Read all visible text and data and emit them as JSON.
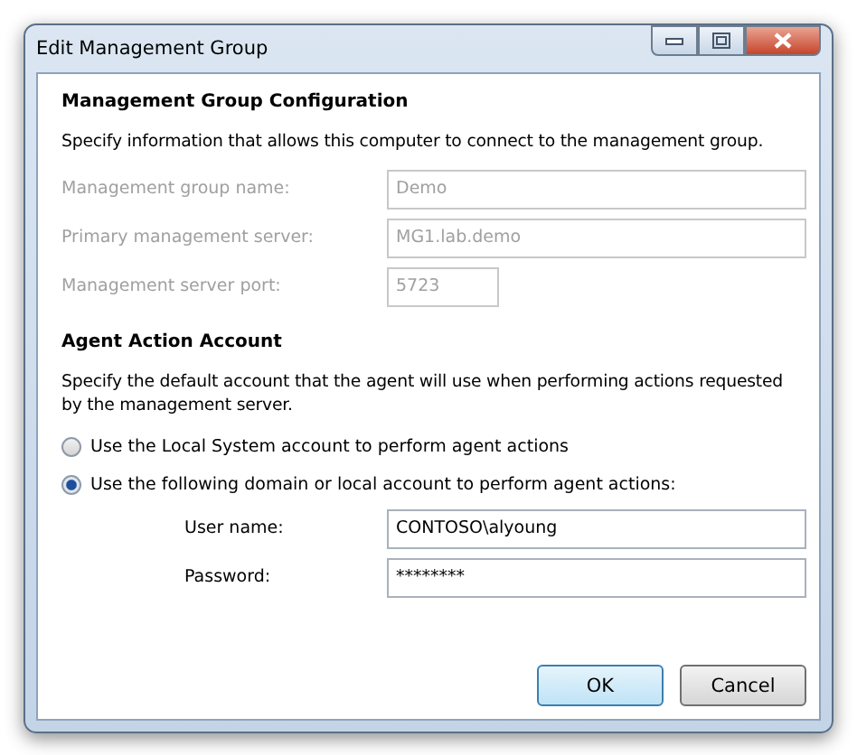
{
  "window": {
    "title": "Edit Management Group"
  },
  "config": {
    "heading": "Management Group Configuration",
    "description": "Specify information that allows this computer to connect to the management group.",
    "fields": [
      {
        "label": "Management group name:",
        "value": "Demo",
        "disabled": true,
        "kind": "wide"
      },
      {
        "label": "Primary management server:",
        "value": "MG1.lab.demo",
        "disabled": true,
        "kind": "wide"
      },
      {
        "label": "Management server port:",
        "value": "5723",
        "disabled": true,
        "kind": "narrow"
      }
    ]
  },
  "account": {
    "heading": "Agent Action Account",
    "description": "Specify the default account that the agent will use when performing actions requested by the management server.",
    "options": [
      {
        "label": "Use the Local System account to perform agent actions",
        "selected": false
      },
      {
        "label": "Use the following domain or local account to perform agent actions:",
        "selected": true
      }
    ],
    "fields": [
      {
        "label": "User name:",
        "value": "CONTOSO\\alyoung",
        "disabled": false,
        "kind": "wide"
      },
      {
        "label": "Password:",
        "value": "********",
        "disabled": false,
        "kind": "wide"
      }
    ]
  },
  "buttons": [
    {
      "label": "OK",
      "default": true
    },
    {
      "label": "Cancel",
      "default": false
    }
  ]
}
